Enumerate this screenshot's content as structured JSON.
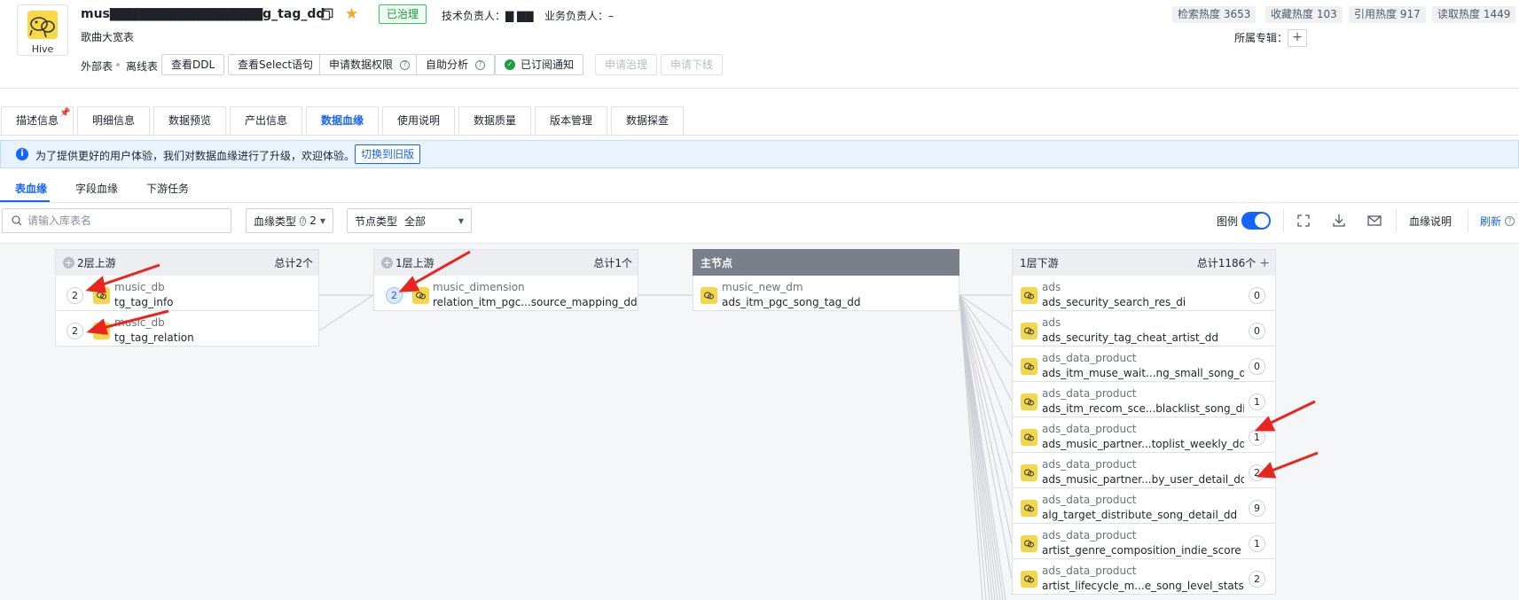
{
  "header": {
    "logo_label": "Hive",
    "table_name": "music_new_dm.ads_itm_pgc_song_tag_dd",
    "table_display": "mus▇▇▇▇▇▇▇▇▇▇▇▇▇▇▇▇g_tag_dd",
    "status_tag": "已治理",
    "tech_owner": "技术负责人：▇ ▇▇",
    "biz_owner": "业务负责人：–",
    "subtitle": "歌曲大宽表",
    "meta_external": "外部表",
    "meta_offline": "离线表",
    "buttons": {
      "view_ddl": "查看DDL",
      "view_select": "查看Select语句",
      "apply_permission": "申请数据权限",
      "self_analysis": "自助分析",
      "subscribed": "已订阅通知",
      "apply_govern": "申请治理",
      "apply_offline": "申请下线"
    },
    "stats": {
      "search": "检索热度 3653",
      "favorite": "收藏热度 103",
      "reference": "引用热度 917",
      "read": "读取热度 1449"
    },
    "album_label": "所属专辑：",
    "album_add": "+"
  },
  "tabs": [
    {
      "label": "描述信息"
    },
    {
      "label": "明细信息"
    },
    {
      "label": "数据预览"
    },
    {
      "label": "产出信息"
    },
    {
      "label": "数据血缘"
    },
    {
      "label": "使用说明"
    },
    {
      "label": "数据质量"
    },
    {
      "label": "版本管理"
    },
    {
      "label": "数据探查"
    }
  ],
  "active_tab": "数据血缘",
  "banner": {
    "text": "为了提供更好的用户体验，我们对数据血缘进行了升级，欢迎体验。",
    "switch_label": "切换到旧版"
  },
  "subtabs": [
    {
      "label": "表血缘"
    },
    {
      "label": "字段血缘"
    },
    {
      "label": "下游任务"
    }
  ],
  "toolbar": {
    "search_placeholder": "请输入库表名",
    "lineage_type_label": "血缘类型",
    "lineage_type_value": "2",
    "node_type_label": "节点类型",
    "node_type_value": "全部",
    "legend_label": "图例",
    "lineage_help": "血缘说明",
    "refresh": "刷新"
  },
  "lineage": {
    "upstream2": {
      "title": "2层上游",
      "total": "总计2个",
      "nodes": [
        {
          "db": "music_db",
          "table": "tg_tag_info",
          "count": "2"
        },
        {
          "db": "music_db",
          "table": "tg_tag_relation",
          "count": "2"
        }
      ]
    },
    "upstream1": {
      "title": "1层上游",
      "total": "总计1个",
      "nodes": [
        {
          "db": "music_dimension",
          "table": "relation_itm_pgc...source_mapping_dd",
          "count": "2"
        }
      ]
    },
    "main": {
      "title": "主节点",
      "nodes": [
        {
          "db": "music_new_dm",
          "table": "ads_itm_pgc_song_tag_dd"
        }
      ]
    },
    "downstream1": {
      "title": "1层下游",
      "total": "总计1186个",
      "nodes": [
        {
          "db": "ads",
          "table": "ads_security_search_res_di",
          "count": "0"
        },
        {
          "db": "ads",
          "table": "ads_security_tag_cheat_artist_dd",
          "count": "0"
        },
        {
          "db": "ads_data_product",
          "table": "ads_itm_muse_wait...ng_small_song_di",
          "count": "0"
        },
        {
          "db": "ads_data_product",
          "table": "ads_itm_recom_sce...blacklist_song_di",
          "count": "1"
        },
        {
          "db": "ads_data_product",
          "table": "ads_music_partner...toplist_weekly_dd",
          "count": "1"
        },
        {
          "db": "ads_data_product",
          "table": "ads_music_partner...by_user_detail_dd",
          "count": "2"
        },
        {
          "db": "ads_data_product",
          "table": "alg_target_distribute_song_detail_dd",
          "count": "9"
        },
        {
          "db": "ads_data_product",
          "table": "artist_genre_composition_indie_score",
          "count": "1"
        },
        {
          "db": "ads_data_product",
          "table": "artist_lifecycle_m...e_song_level_stats",
          "count": "2"
        }
      ]
    }
  },
  "colors": {
    "accent": "#1664ff",
    "govern_green": "#1c9c3e",
    "annotation_red": "#e8261f",
    "node_icon_yellow": "#f2d64b"
  }
}
